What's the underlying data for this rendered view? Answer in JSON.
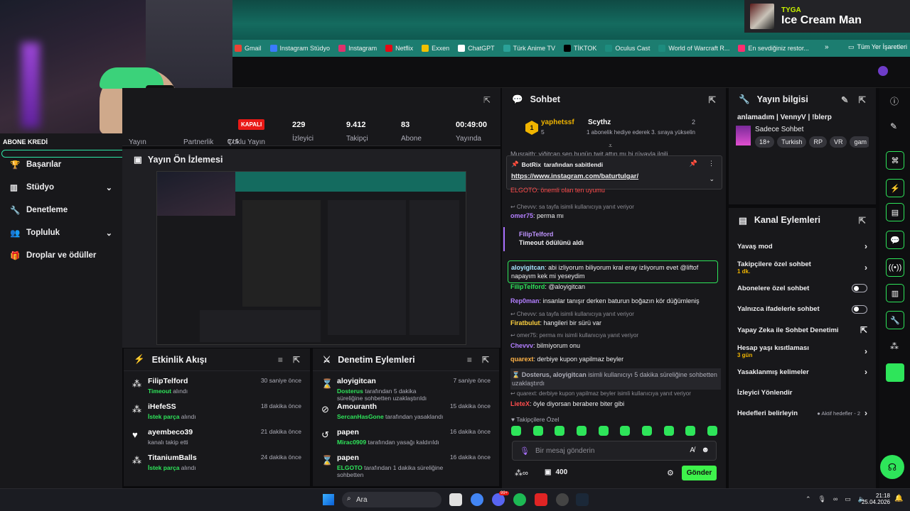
{
  "now_playing": {
    "artist": "TYGA",
    "song": "Ice Cream Man"
  },
  "bookmarks": [
    {
      "label": "Gmail",
      "color": "#ea4335"
    },
    {
      "label": "Instagram Stüdyo",
      "color": "#3a7bff"
    },
    {
      "label": "Instagram",
      "color": "#e1306c"
    },
    {
      "label": "Netflix",
      "color": "#e50914"
    },
    {
      "label": "Exxen",
      "color": "#f0c000"
    },
    {
      "label": "ChatGPT",
      "color": "#ffffff"
    },
    {
      "label": "Türk Anime TV",
      "color": "#2aa198"
    },
    {
      "label": "TİKTOK",
      "color": "#000000"
    },
    {
      "label": "Oculus Cast",
      "color": "#1d8c7e"
    },
    {
      "label": "World of Warcraft R...",
      "color": "#1d8c7e"
    },
    {
      "label": "En sevdiğiniz restor...",
      "color": "#ff2d6f"
    }
  ],
  "bookmarks_all": "Tüm Yer İşaretleri",
  "left_nav": {
    "partial_label": "ABONE KREDİ",
    "items": [
      {
        "label": "Başarılar",
        "icon": "trophy-icon"
      },
      {
        "label": "Stüdyo",
        "icon": "studio-icon",
        "chevron": true
      },
      {
        "label": "Denetleme",
        "icon": "wrench-icon"
      },
      {
        "label": "Topluluk",
        "icon": "people-icon",
        "chevron": true
      },
      {
        "label": "Droplar ve ödüller",
        "icon": "gift-icon"
      }
    ]
  },
  "stats": {
    "yayin": "Yayın",
    "partnerlik": "Partnerlik",
    "partnerlik_val": "0 / 5",
    "coklu": "Çoklu Yayın",
    "status": "KAPALI",
    "izleyici": {
      "value": "229",
      "label": "İzleyici"
    },
    "takipci": {
      "value": "9.412",
      "label": "Takipçi"
    },
    "abone": {
      "value": "83",
      "label": "Abone"
    },
    "yayinda": {
      "value": "00:49:00",
      "label": "Yayında"
    }
  },
  "preview": {
    "title": "Yayın Ön İzlemesi"
  },
  "activity": {
    "title": "Etkinlik Akışı",
    "events": [
      {
        "name": "FilipTelford",
        "sub_hl": "Timeout",
        "sub": "alındı",
        "time": "30 saniye önce",
        "icon": "channel-points-icon"
      },
      {
        "name": "iHefeSS",
        "sub_hl": "İstek parça",
        "sub": "alındı",
        "time": "18 dakika önce",
        "icon": "channel-points-icon"
      },
      {
        "name": "ayembeco39",
        "sub_hl": "",
        "sub": "kanalı takip etti",
        "time": "21 dakika önce",
        "icon": "heart-icon"
      },
      {
        "name": "TitaniumBalls",
        "sub_hl": "İstek parça",
        "sub": "alındı",
        "time": "24 dakika önce",
        "icon": "channel-points-icon"
      }
    ]
  },
  "moderation": {
    "title": "Denetim Eylemleri",
    "events": [
      {
        "name": "aloyigitcan",
        "sub_hl": "Dosterus",
        "sub": "tarafından 5 dakika süreliğine sohbetten uzaklaştırıldı",
        "time": "7 saniye önce",
        "icon": "hourglass-icon"
      },
      {
        "name": "Amouranth",
        "sub_hl": "SercanHasGone",
        "sub": "tarafından yasaklandı",
        "time": "15 dakika önce",
        "icon": "ban-icon"
      },
      {
        "name": "papen",
        "sub_hl": "Mirac0909",
        "sub": "tarafından yasağı kaldırıldı",
        "time": "16 dakika önce",
        "icon": "undo-icon"
      },
      {
        "name": "papen",
        "sub_hl": "ELGOTO",
        "sub": "tarafından 1 dakika süreliğine sohbetten",
        "time": "16 dakika önce",
        "icon": "hourglass-icon"
      }
    ]
  },
  "chat": {
    "title": "Sohbet",
    "gifter": {
      "name": "yaphetssf",
      "count": "5",
      "level": "1",
      "other": "Scythz",
      "other_count": "2",
      "note": "1 abonelik hediye ederek 3. sıraya yükselin"
    },
    "pinned": {
      "by": "BotRix",
      "by_suffix": "tarafından sabitlendi",
      "link": "https://www.instagram.com/baturtulgar/"
    },
    "partial_top": "Musraith: yiğitcan sen bugün twit attın mı bi rüyayla ilgili",
    "partial_top2": "ELGOTO: önemli olan ten uyumu",
    "messages": [
      {
        "type": "reply",
        "text": "Chevvv: sa tayfa isimli kullanıcıya yanıt veriyor"
      },
      {
        "user": "omer75",
        "color": "#b37fff",
        "text": ": perma mı"
      },
      {
        "type": "timeout",
        "user": "FilipTelford",
        "text": "Timeout ödülünü aldı"
      },
      {
        "type": "highlight",
        "user": "aloyigitcan",
        "color": "#a7e6ff",
        "text": ": abi izliyorum biliyorum kral eray izliyorum evet @liftof napayım kek mi yeseydim"
      },
      {
        "user": "FilipTelford",
        "color": "#2ee55a",
        "text": ": @aloyigitcan"
      },
      {
        "user": "Rep0man",
        "color": "#b37fff",
        "text": ": insanlar tanışır derken baturun boğazın kör düğümleniş"
      },
      {
        "type": "reply",
        "text": "Chevvv: sa tayfa isimli kullanıcıya yanıt veriyor"
      },
      {
        "user": "Firatbulut",
        "color": "#ffd23f",
        "text": ": hangileri bir sürü var"
      },
      {
        "type": "reply",
        "text": "omer75: perma mı isimli kullanıcıya yanıt veriyor"
      },
      {
        "user": "Chevvv",
        "color": "#b37fff",
        "text": ": bilmiyorum onu"
      },
      {
        "user": "quarext",
        "color": "#ffb347",
        "text": ": derbiye kupon yapilmaz beyler"
      },
      {
        "type": "mod",
        "user": "Dosterus, aloyigitcan",
        "text": "isimli kullanıcıyı 5 dakika süreliğine sohbetten uzaklaştırdı"
      },
      {
        "type": "reply",
        "text": "quarext: derbiye kupon yapilmaz beyler isimli kullanıcıya yanıt veriyor"
      },
      {
        "user": "LieteX",
        "color": "#ff4d4d",
        "text": ": öyle diyorsan berabere biter gibi"
      }
    ],
    "emote_bar_label": "Takipçilere Özel",
    "input_placeholder": "Bir mesaj gönderin",
    "points": "400",
    "send": "Gönder"
  },
  "stream_info": {
    "title": "Yayın bilgisi",
    "stream_title": "anlamadım  | VennyV | !blerp",
    "category": "Sadece Sohbet",
    "tags": [
      "18+",
      "Turkish",
      "RP",
      "VR",
      "gam"
    ]
  },
  "channel_actions": {
    "title": "Kanal Eylemleri",
    "items": [
      {
        "label": "Yavaş mod",
        "kind": "chevron"
      },
      {
        "label": "Takipçilere özel sohbet",
        "sub": "1 dk.",
        "kind": "chevron"
      },
      {
        "label": "Abonelere özel sohbet",
        "kind": "toggle"
      },
      {
        "label": "Yalnızca ifadelerle sohbet",
        "kind": "toggle"
      },
      {
        "label": "Yapay Zeka ile Sohbet Denetimi",
        "kind": "external"
      },
      {
        "label": "Hesap yaşı kısıtlaması",
        "sub": "3 gün",
        "kind": "chevron"
      },
      {
        "label": "Yasaklanmış kelimeler",
        "kind": "chevron"
      },
      {
        "label": "İzleyici Yönlendir",
        "kind": "none"
      },
      {
        "label": "Hedefleri belirleyin",
        "aside": "Aktif hedefler - 2",
        "kind": "chevron"
      }
    ]
  },
  "taskbar": {
    "search": "Ara",
    "time": "21:18",
    "date": "25.04.2026",
    "badge": "99+"
  },
  "colors": {
    "accent": "#2ee55a",
    "live_red": "#e91916",
    "panel": "#18181b"
  }
}
